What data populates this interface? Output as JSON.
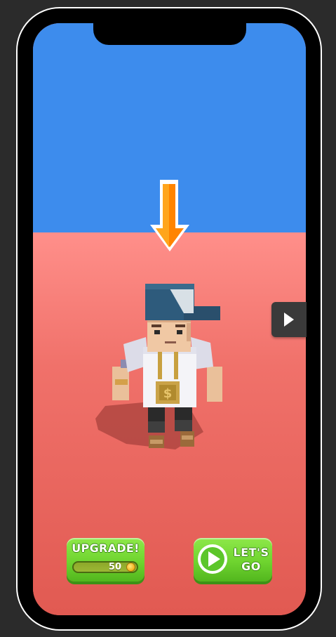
{
  "game": {
    "upgrade_label": "UPGRADE!",
    "upgrade_cost": "50",
    "start_label_line1": "LET'S",
    "start_label_line2": "GO"
  },
  "icons": {
    "next": "next-arrow-icon",
    "coin": "coin-icon",
    "play": "play-icon",
    "indicator": "down-arrow-icon"
  },
  "colors": {
    "sky": "#3d8ced",
    "ground": "#e8615a",
    "button_green": "#6fd42f",
    "indicator_orange": "#ff8a00"
  }
}
